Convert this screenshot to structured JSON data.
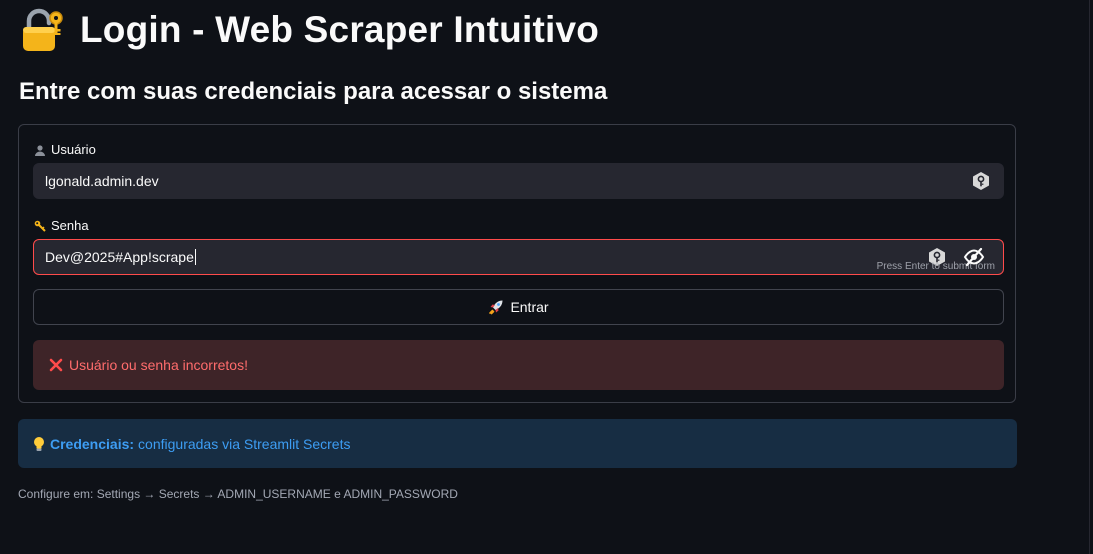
{
  "page": {
    "title": "Login - Web Scraper Intuitivo",
    "title_icon": "lock-with-key-icon",
    "subtitle": "Entre com suas credenciais para acessar o sistema"
  },
  "form": {
    "username": {
      "label": "Usuário",
      "label_icon": "bust-in-silhouette-icon",
      "value": "lgonald.admin.dev",
      "suffix_icon": "password-manager-key-icon"
    },
    "password": {
      "label": "Senha",
      "label_icon": "key-icon",
      "value": "Dev@2025#App!scrape",
      "suffix_icon": "password-manager-key-icon",
      "toggle_icon": "eye-off-icon",
      "hint": "Press Enter to submit form",
      "state": "error"
    },
    "submit": {
      "label": "Entrar",
      "icon": "rocket-icon"
    },
    "error": {
      "icon": "cross-mark-icon",
      "text": "Usuário ou senha incorretos!"
    }
  },
  "info": {
    "icon": "light-bulb-icon",
    "strong": "Credenciais:",
    "text": "configuradas via Streamlit Secrets"
  },
  "caption": "Configure em: Settings → Secrets → ADMIN_USERNAME e ADMIN_PASSWORD",
  "colors": {
    "background": "#0e1117",
    "input_bg": "#262730",
    "error_border": "#ff4b4b",
    "error_bg": "#3e2428",
    "error_text": "#ff6c6c",
    "info_bg": "#172d43",
    "info_text": "#3d9df3"
  }
}
